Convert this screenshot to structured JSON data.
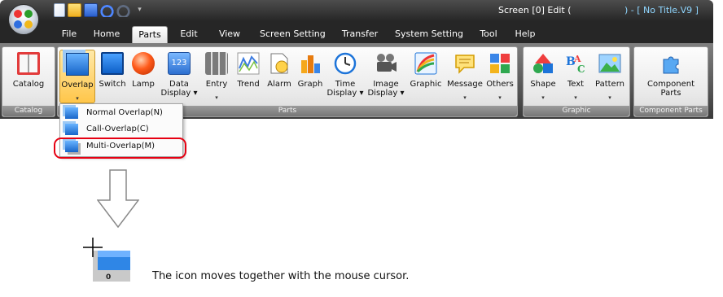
{
  "window": {
    "title": "Screen [0] Edit (",
    "document": ") - [ No Title.V9 ]"
  },
  "tabs": [
    "File",
    "Home",
    "Parts",
    "Edit",
    "View",
    "Screen Setting",
    "Transfer",
    "System Setting",
    "Tool",
    "Help"
  ],
  "active_tab": "Parts",
  "ribbon": {
    "catalog_group": {
      "buttons": [
        {
          "line1": "Catalog",
          "line2": ""
        }
      ],
      "label": "Catalog"
    },
    "parts_group": {
      "buttons": [
        {
          "line1": "Overlap",
          "line2": "",
          "dropdown": true,
          "selected": true,
          "icon": "overlap-icon"
        },
        {
          "line1": "Switch",
          "line2": "",
          "dropdown": false,
          "icon": "switch-icon"
        },
        {
          "line1": "Lamp",
          "line2": "",
          "dropdown": false,
          "icon": "lamp-icon"
        },
        {
          "line1": "Data",
          "line2": "Display ▾",
          "dropdown": false,
          "icon": "data-display-icon"
        },
        {
          "line1": "Entry",
          "line2": "",
          "dropdown": true,
          "icon": "entry-icon"
        },
        {
          "line1": "Trend",
          "line2": "",
          "dropdown": false,
          "icon": "trend-icon"
        },
        {
          "line1": "Alarm",
          "line2": "",
          "dropdown": false,
          "icon": "alarm-icon"
        },
        {
          "line1": "Graph",
          "line2": "",
          "dropdown": false,
          "icon": "graph-icon"
        },
        {
          "line1": "Time",
          "line2": "Display ▾",
          "dropdown": false,
          "icon": "time-display-icon"
        },
        {
          "line1": "Image",
          "line2": "Display ▾",
          "dropdown": false,
          "icon": "image-display-icon"
        },
        {
          "line1": "Graphic",
          "line2": "",
          "dropdown": false,
          "icon": "graphic-icon"
        },
        {
          "line1": "Message",
          "line2": "",
          "dropdown": true,
          "icon": "message-icon"
        },
        {
          "line1": "Others",
          "line2": "",
          "dropdown": true,
          "icon": "others-icon"
        }
      ],
      "label": "Parts"
    },
    "graphic_group": {
      "buttons": [
        {
          "line1": "Shape",
          "line2": "",
          "dropdown": true,
          "icon": "shape-icon"
        },
        {
          "line1": "Text",
          "line2": "",
          "dropdown": true,
          "icon": "text-icon"
        },
        {
          "line1": "Pattern",
          "line2": "",
          "dropdown": true,
          "icon": "pattern-icon"
        }
      ],
      "label": "Graphic"
    },
    "component_group": {
      "buttons": [
        {
          "line1": "Component",
          "line2": "Parts",
          "icon": "component-parts-icon"
        }
      ],
      "label": "Component Parts"
    }
  },
  "overlap_menu": {
    "items": [
      "Normal Overlap(N)",
      "Call-Overlap(C)",
      "Multi-Overlap(M)"
    ],
    "highlighted": "Multi-Overlap(M)"
  },
  "drag_preview": {
    "counter": "0"
  },
  "caption": "The icon moves together with the mouse cursor.",
  "colors": {
    "highlight_ring": "#e60012",
    "selected_button": "#ffc64a",
    "title_doc": "#8fd6ff"
  }
}
